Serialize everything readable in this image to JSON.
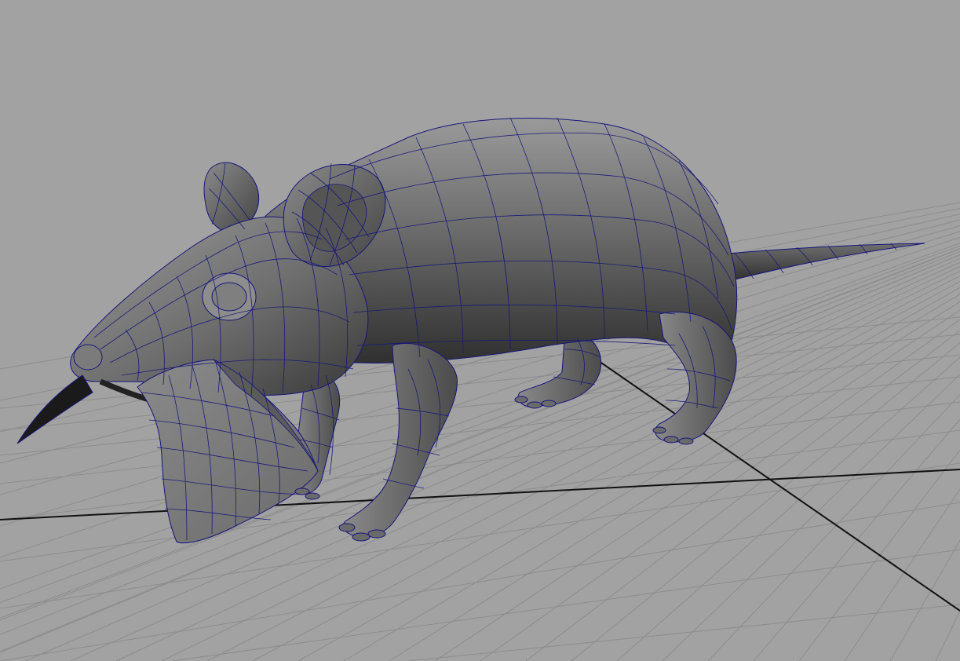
{
  "viewport": {
    "background_color": "#a2a2a2",
    "grid_color": "#8c8c8c",
    "axis_color": "#111111",
    "wireframe_color": "#17157a",
    "model_color": "#747474"
  },
  "scene": {
    "object": "mouse",
    "held_item": "cheese-wedge",
    "display_mode": "smooth-shade-with-wireframe",
    "grid_visible": true
  }
}
